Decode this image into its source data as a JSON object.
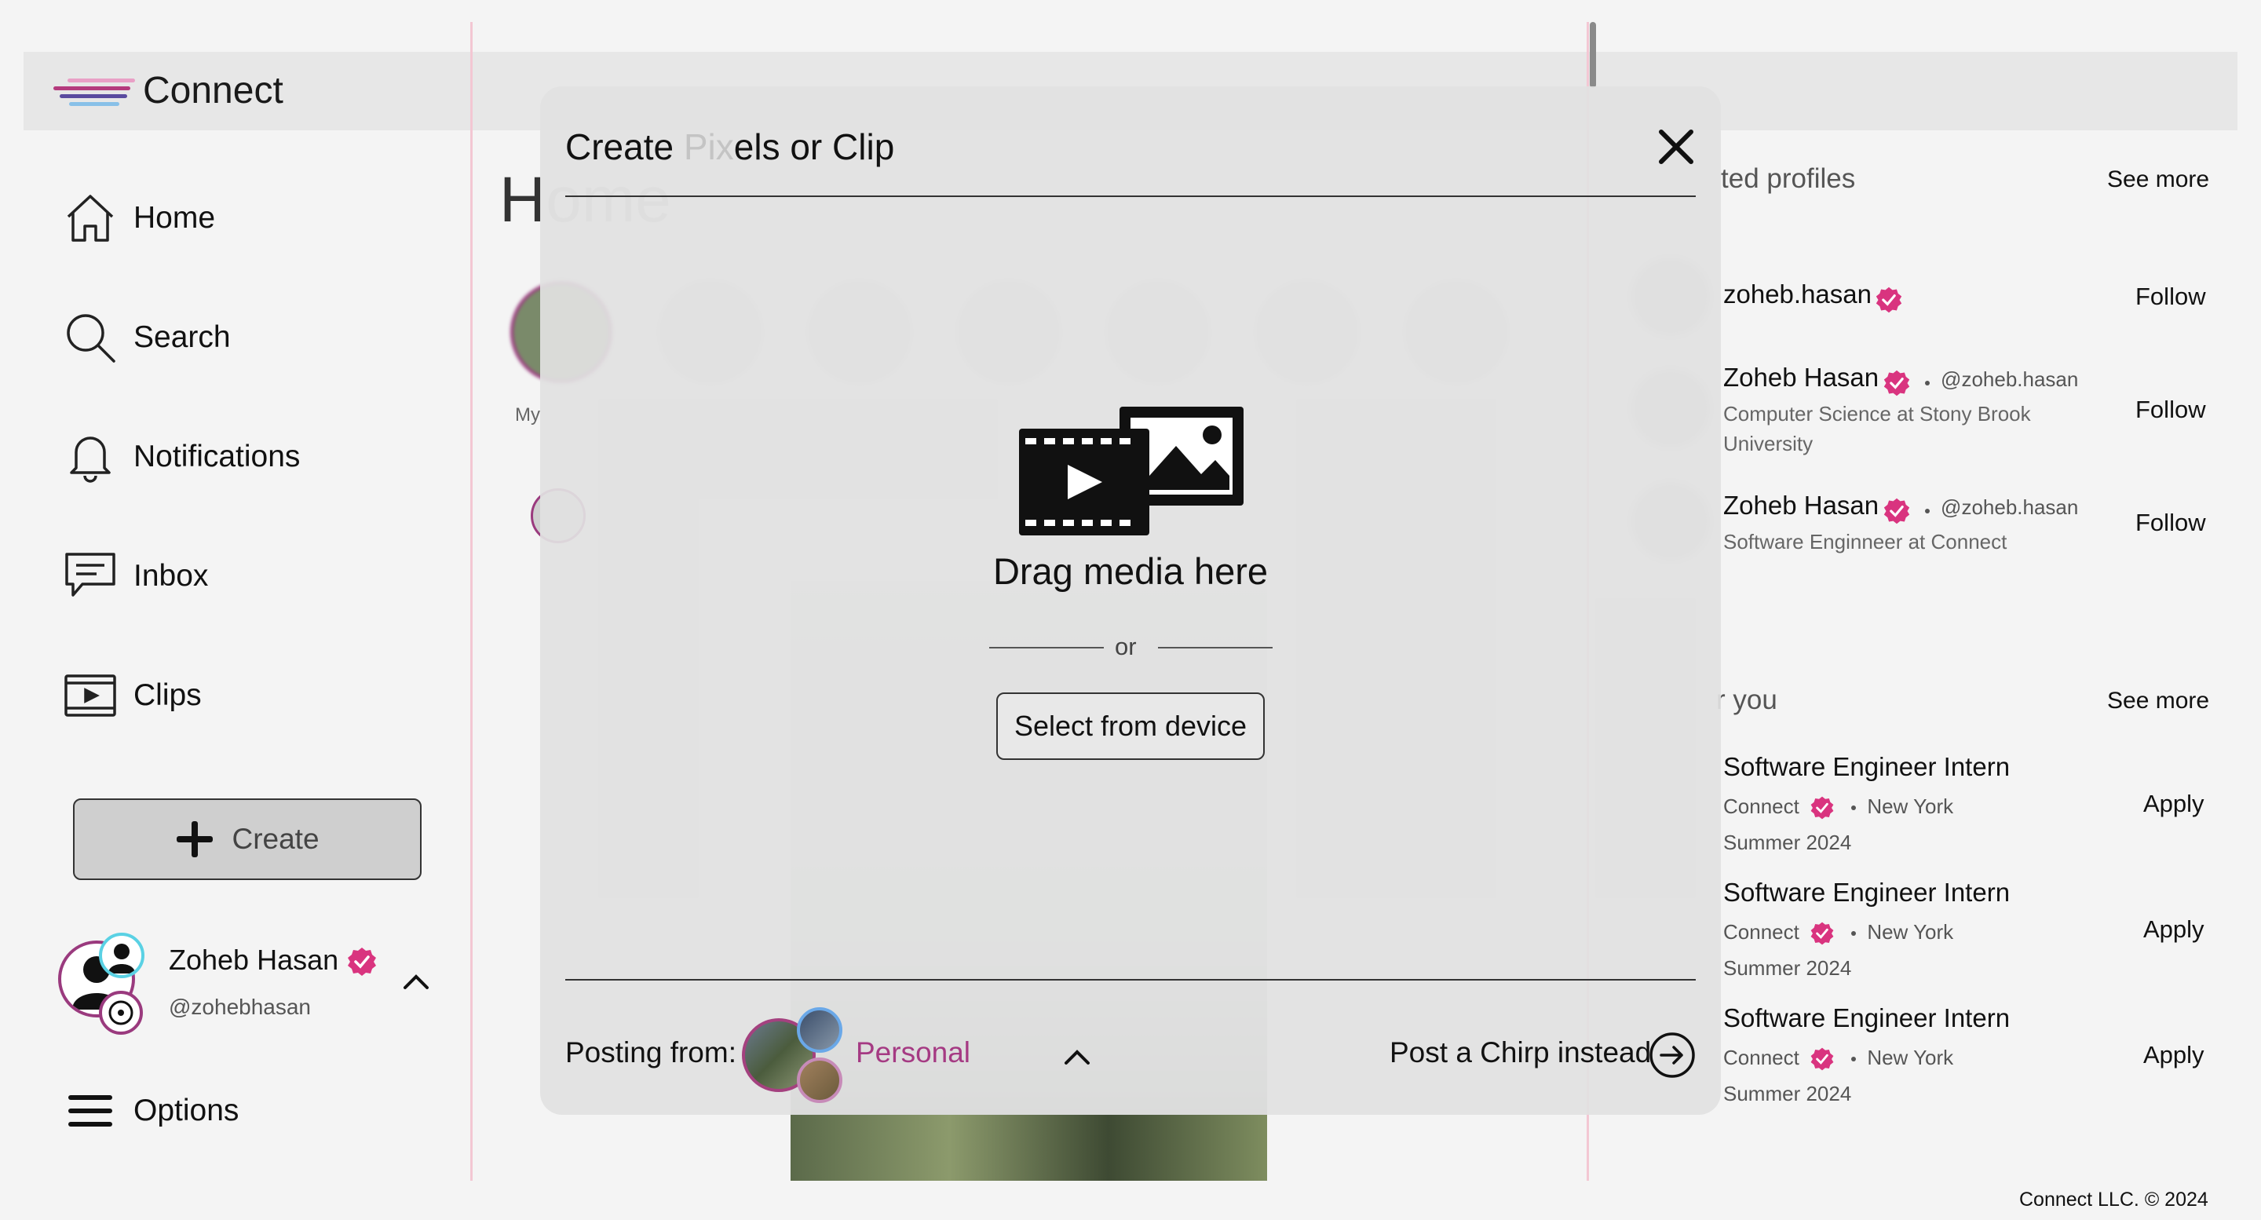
{
  "app": {
    "name": "Connect"
  },
  "nav": {
    "items": [
      {
        "label": "Home",
        "icon": "home-icon"
      },
      {
        "label": "Search",
        "icon": "search-icon"
      },
      {
        "label": "Notifications",
        "icon": "bell-icon"
      },
      {
        "label": "Inbox",
        "icon": "inbox-icon"
      },
      {
        "label": "Clips",
        "icon": "clips-icon"
      }
    ],
    "create_label": "Create",
    "options_label": "Options"
  },
  "profile": {
    "name": "Zoheb Hasan",
    "handle": "@zohebhasan"
  },
  "feed": {
    "heading_visible": "H",
    "heading_ghost": "ome",
    "story_first_label": "My"
  },
  "right_panel": {
    "suggested": {
      "title_partial": "ted profiles",
      "see_more": "See more",
      "profiles": [
        {
          "name": "zoheb.hasan",
          "handle": "",
          "sub1": "",
          "sub2": "",
          "action": "Follow"
        },
        {
          "name": "Zoheb Hasan",
          "handle": "@zoheb.hasan",
          "sub1": "Computer Science at Stony Brook",
          "sub2": "University",
          "action": "Follow"
        },
        {
          "name": "Zoheb Hasan",
          "handle": "@zoheb.hasan",
          "sub1": "Software Enginneer at Connect",
          "sub2": "",
          "action": "Follow"
        }
      ]
    },
    "jobs": {
      "title_partial": "r you",
      "see_more": "See more",
      "items": [
        {
          "title": "Software Engineer Intern",
          "company": "Connect",
          "location": "New York",
          "term": "Summer 2024",
          "action": "Apply"
        },
        {
          "title": "Software Engineer Intern",
          "company": "Connect",
          "location": "New York",
          "term": "Summer 2024",
          "action": "Apply"
        },
        {
          "title": "Software Engineer Intern",
          "company": "Connect",
          "location": "New York",
          "term": "Summer 2024",
          "action": "Apply"
        }
      ]
    }
  },
  "footer": "Connect LLC. © 2024",
  "modal": {
    "title_start": "Create ",
    "title_ghost": "Pix",
    "title_end": "els or Clip",
    "drag_text": "Drag media here",
    "or_text": "or",
    "select_button": "Select from device",
    "posting_label": "Posting from:",
    "posting_account": "Personal",
    "chirp_link": "Post a Chirp instead"
  },
  "colors": {
    "accent": "#a53a83",
    "verified": "#d9347f",
    "divider": "#f3c7d3",
    "modal_bg": "#e1e1e1"
  }
}
